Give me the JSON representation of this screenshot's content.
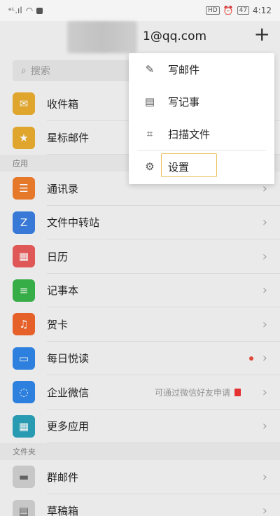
{
  "statusbar": {
    "signal": "ᵉᴸ.ıl",
    "time": "4:12",
    "hd": "HD",
    "battery": "47"
  },
  "header": {
    "account": "1@qq.com",
    "compose_plus": "+"
  },
  "search": {
    "placeholder": "搜索"
  },
  "inbox": [
    {
      "label": "收件箱",
      "icon": "✉",
      "color": "#e9ac2e"
    },
    {
      "label": "星标邮件",
      "icon": "★",
      "color": "#e9ac2e"
    }
  ],
  "sections": {
    "apps": "应用",
    "folders": "文件夹"
  },
  "apps": [
    {
      "label": "通讯录",
      "icon": "☰",
      "color": "#f07d2c"
    },
    {
      "label": "文件中转站",
      "icon": "Z",
      "color": "#3b7de0"
    },
    {
      "label": "日历",
      "icon": "▦",
      "color": "#ea5b5b"
    },
    {
      "label": "记事本",
      "icon": "≡",
      "color": "#39b54a"
    },
    {
      "label": "贺卡",
      "icon": "♫",
      "color": "#f0642c"
    },
    {
      "label": "每日悦读",
      "icon": "▭",
      "color": "#2f86e6"
    },
    {
      "label": "企业微信",
      "icon": "◌",
      "color": "#2f86e6"
    },
    {
      "label": "更多应用",
      "icon": "▦",
      "color": "#2aa1b9"
    }
  ],
  "apps_extra": {
    "enterprise_hint": "可通过微信好友申请"
  },
  "folders": [
    {
      "label": "群邮件",
      "icon": "▬",
      "color": "#d0d0d0"
    },
    {
      "label": "草稿箱",
      "icon": "▤",
      "color": "#d0d0d0"
    }
  ],
  "chevron": "›",
  "menu": [
    {
      "label": "写邮件",
      "icon": "✎"
    },
    {
      "label": "写记事",
      "icon": "▤"
    },
    {
      "label": "扫描文件",
      "icon": "⌗"
    },
    {
      "label": "设置",
      "icon": "⚙"
    }
  ]
}
